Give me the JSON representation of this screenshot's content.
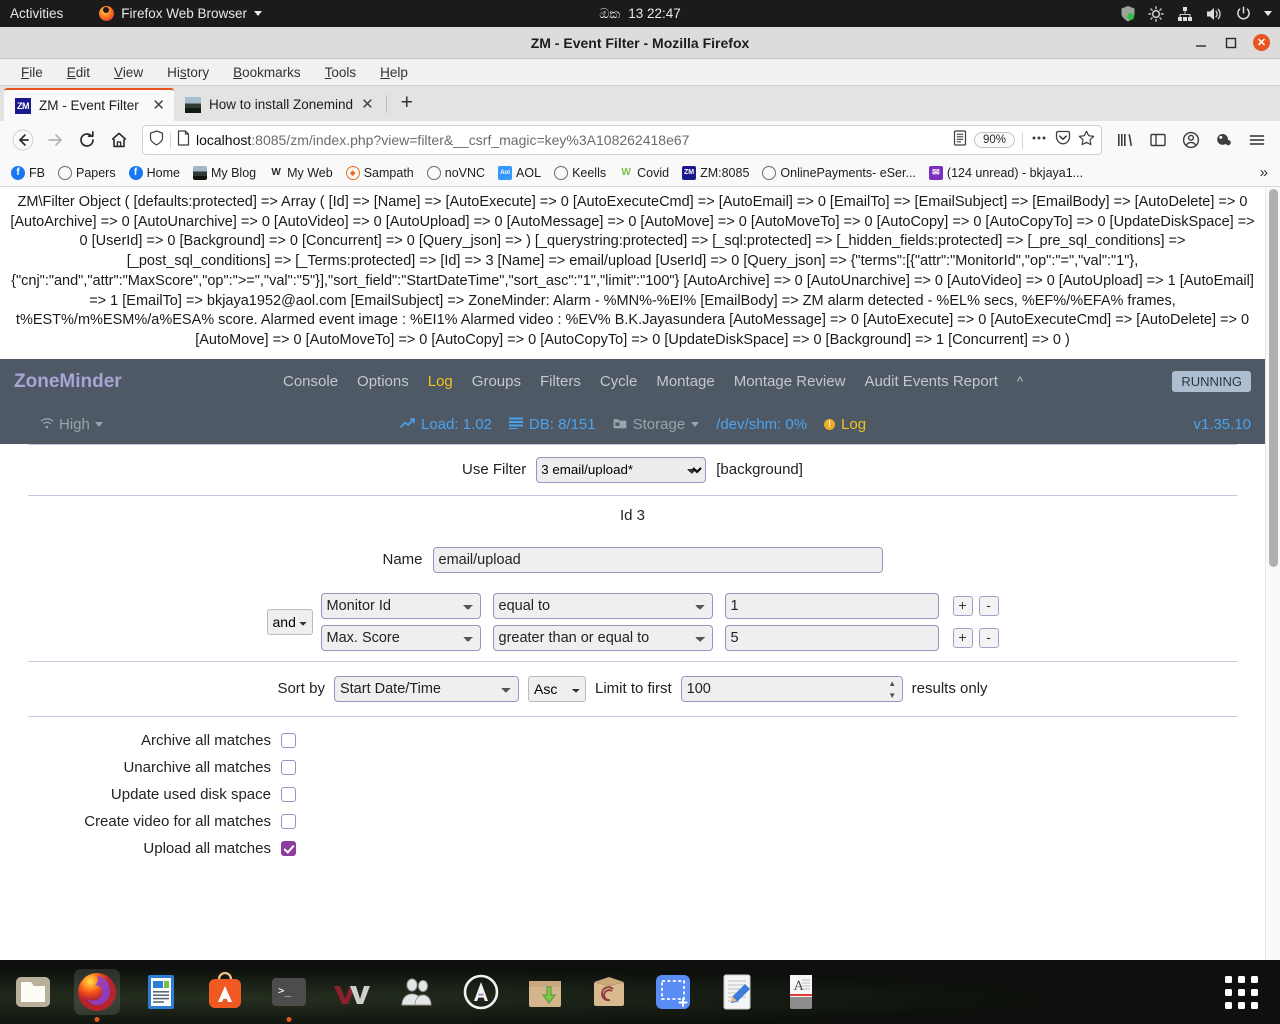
{
  "gnome": {
    "activities": "Activities",
    "app_name": "Firefox Web Browser",
    "clock_locale": "ඔක",
    "clock": "13  22:47"
  },
  "firefox": {
    "window_title": "ZM - Event Filter - Mozilla Firefox",
    "menubar": [
      "File",
      "Edit",
      "View",
      "History",
      "Bookmarks",
      "Tools",
      "Help"
    ],
    "tabs": [
      {
        "label": "ZM - Event Filter",
        "favicon": "zm-favicon",
        "active": true
      },
      {
        "label": "How to install Zonemind",
        "favicon": "image-favicon",
        "active": false
      }
    ],
    "new_tab_label": "+",
    "url_host": "localhost",
    "url_rest": ":8085/zm/index.php?view=filter&__csrf_magic=key%3A108262418e67",
    "zoom_level": "90%",
    "bookmarks": [
      {
        "label": "FB",
        "icon": "facebook-icon",
        "color": "#1877f2"
      },
      {
        "label": "Papers",
        "icon": "globe-icon",
        "color": "#6b6b6b"
      },
      {
        "label": "Home",
        "icon": "facebook-icon",
        "color": "#1877f2"
      },
      {
        "label": "My Blog",
        "icon": "image-icon",
        "color": "#3b4a3b"
      },
      {
        "label": "My Web",
        "icon": "wikipedia-w-icon",
        "color": "#2b2b2b"
      },
      {
        "label": "Sampath",
        "icon": "sampath-icon",
        "color": "#ef6c1a"
      },
      {
        "label": "noVNC",
        "icon": "globe-icon",
        "color": "#6b6b6b"
      },
      {
        "label": "AOL",
        "icon": "aol-icon",
        "color": "#3399ff"
      },
      {
        "label": "Keells",
        "icon": "globe-icon",
        "color": "#6b6b6b"
      },
      {
        "label": "Covid",
        "icon": "wikipedia-w-icon",
        "color": "#79c143"
      },
      {
        "label": "ZM:8085",
        "icon": "zm-favicon",
        "color": "#1a1a8c"
      },
      {
        "label": "OnlinePayments- eSer...",
        "icon": "globe-icon",
        "color": "#6b6b6b"
      },
      {
        "label": "(124 unread) - bkjaya1...",
        "icon": "mail-icon",
        "color": "#7b2fbe"
      }
    ],
    "bookmarks_overflow": "»"
  },
  "debug_dump": "ZM\\Filter Object ( [defaults:protected] => Array ( [Id] => [Name] => [AutoExecute] => 0 [AutoExecuteCmd] => [AutoEmail] => 0 [EmailTo] => [EmailSubject] => [EmailBody] => [AutoDelete] => 0 [AutoArchive] => 0 [AutoUnarchive] => 0 [AutoVideo] => 0 [AutoUpload] => 0 [AutoMessage] => 0 [AutoMove] => 0 [AutoMoveTo] => 0 [AutoCopy] => 0 [AutoCopyTo] => 0 [UpdateDiskSpace] => 0 [UserId] => 0 [Background] => 0 [Concurrent] => 0 [Query_json] => ) [_querystring:protected] => [_sql:protected] => [_hidden_fields:protected] => [_pre_sql_conditions] => [_post_sql_conditions] => [_Terms:protected] => [Id] => 3 [Name] => email/upload [UserId] => 0 [Query_json] => {\"terms\":[{\"attr\":\"MonitorId\",\"op\":\"=\",\"val\":\"1\"},{\"cnj\":\"and\",\"attr\":\"MaxScore\",\"op\":\">=\",\"val\":\"5\"}],\"sort_field\":\"StartDateTime\",\"sort_asc\":\"1\",\"limit\":\"100\"} [AutoArchive] => 0 [AutoUnarchive] => 0 [AutoVideo] => 0 [AutoUpload] => 1 [AutoEmail] => 1 [EmailTo] => bkjaya1952@aol.com [EmailSubject] => ZoneMinder: Alarm - %MN%-%EI% [EmailBody] => ZM alarm detected - %EL% secs, %EF%/%EFA% frames, t%EST%/m%ESM%/a%ESA% score. Alarmed event image : %EI1% Alarmed video : %EV% B.K.Jayasundera [AutoMessage] => 0 [AutoExecute] => 0 [AutoExecuteCmd] => [AutoDelete] => 0 [AutoMove] => 0 [AutoMoveTo] => 0 [AutoCopy] => 0 [AutoCopyTo] => 0 [UpdateDiskSpace] => 0 [Background] => 1 [Concurrent] => 0 )",
  "zoneminder": {
    "brand": "ZoneMinder",
    "menu": [
      {
        "label": "Console",
        "active": false
      },
      {
        "label": "Options",
        "active": false
      },
      {
        "label": "Log",
        "active": true
      },
      {
        "label": "Groups",
        "active": false
      },
      {
        "label": "Filters",
        "active": false
      },
      {
        "label": "Cycle",
        "active": false
      },
      {
        "label": "Montage",
        "active": false
      },
      {
        "label": "Montage Review",
        "active": false
      },
      {
        "label": "Audit Events Report",
        "active": false
      }
    ],
    "collapse_caret": "^",
    "status_badge": "RUNNING",
    "bandwidth": "High",
    "load": "Load: 1.02",
    "db": "DB: 8/151",
    "storage": "Storage",
    "shm": "/dev/shm: 0%",
    "log": "Log",
    "version": "v1.35.10",
    "accent_active": "#f0c419",
    "accent_link": "#4aa3f0",
    "navbar_bg": "#4e5965"
  },
  "filter": {
    "use_filter_label": "Use Filter",
    "use_filter_value": "3 email/upload*",
    "background_tag": "[background]",
    "id_line": "Id 3",
    "name_label": "Name",
    "name_value": "email/upload",
    "conjunction": "and",
    "conditions": [
      {
        "attr": "Monitor Id",
        "op": "equal to",
        "val": "1",
        "add": "+",
        "remove": "-"
      },
      {
        "attr": "Max. Score",
        "op": "greater than or equal to",
        "val": "5",
        "add": "+",
        "remove": "-"
      }
    ],
    "sort_by_label": "Sort by",
    "sort_field": "Start Date/Time",
    "sort_dir": "Asc",
    "limit_label": "Limit to first",
    "limit_value": "100",
    "results_label": "results only",
    "checkboxes": [
      {
        "label": "Archive all matches",
        "checked": false
      },
      {
        "label": "Unarchive all matches",
        "checked": false
      },
      {
        "label": "Update used disk space",
        "checked": false
      },
      {
        "label": "Create video for all matches",
        "checked": false
      },
      {
        "label": "Upload all matches",
        "checked": true
      }
    ]
  },
  "dock": {
    "items": [
      {
        "name": "files-icon",
        "running": false
      },
      {
        "name": "firefox-icon",
        "running": true
      },
      {
        "name": "libreoffice-impress-icon",
        "running": false
      },
      {
        "name": "ubuntu-software-icon",
        "running": false
      },
      {
        "name": "terminal-icon",
        "running": true
      },
      {
        "name": "vmware-icon",
        "running": false
      },
      {
        "name": "users-icon",
        "running": false
      },
      {
        "name": "anbox-icon",
        "running": false
      },
      {
        "name": "software-updater-icon",
        "running": false
      },
      {
        "name": "debian-package-icon",
        "running": false
      },
      {
        "name": "screenshot-icon",
        "running": false
      },
      {
        "name": "text-editor-icon",
        "running": false
      },
      {
        "name": "fonts-icon",
        "running": false
      }
    ],
    "show_apps": "show-applications"
  }
}
